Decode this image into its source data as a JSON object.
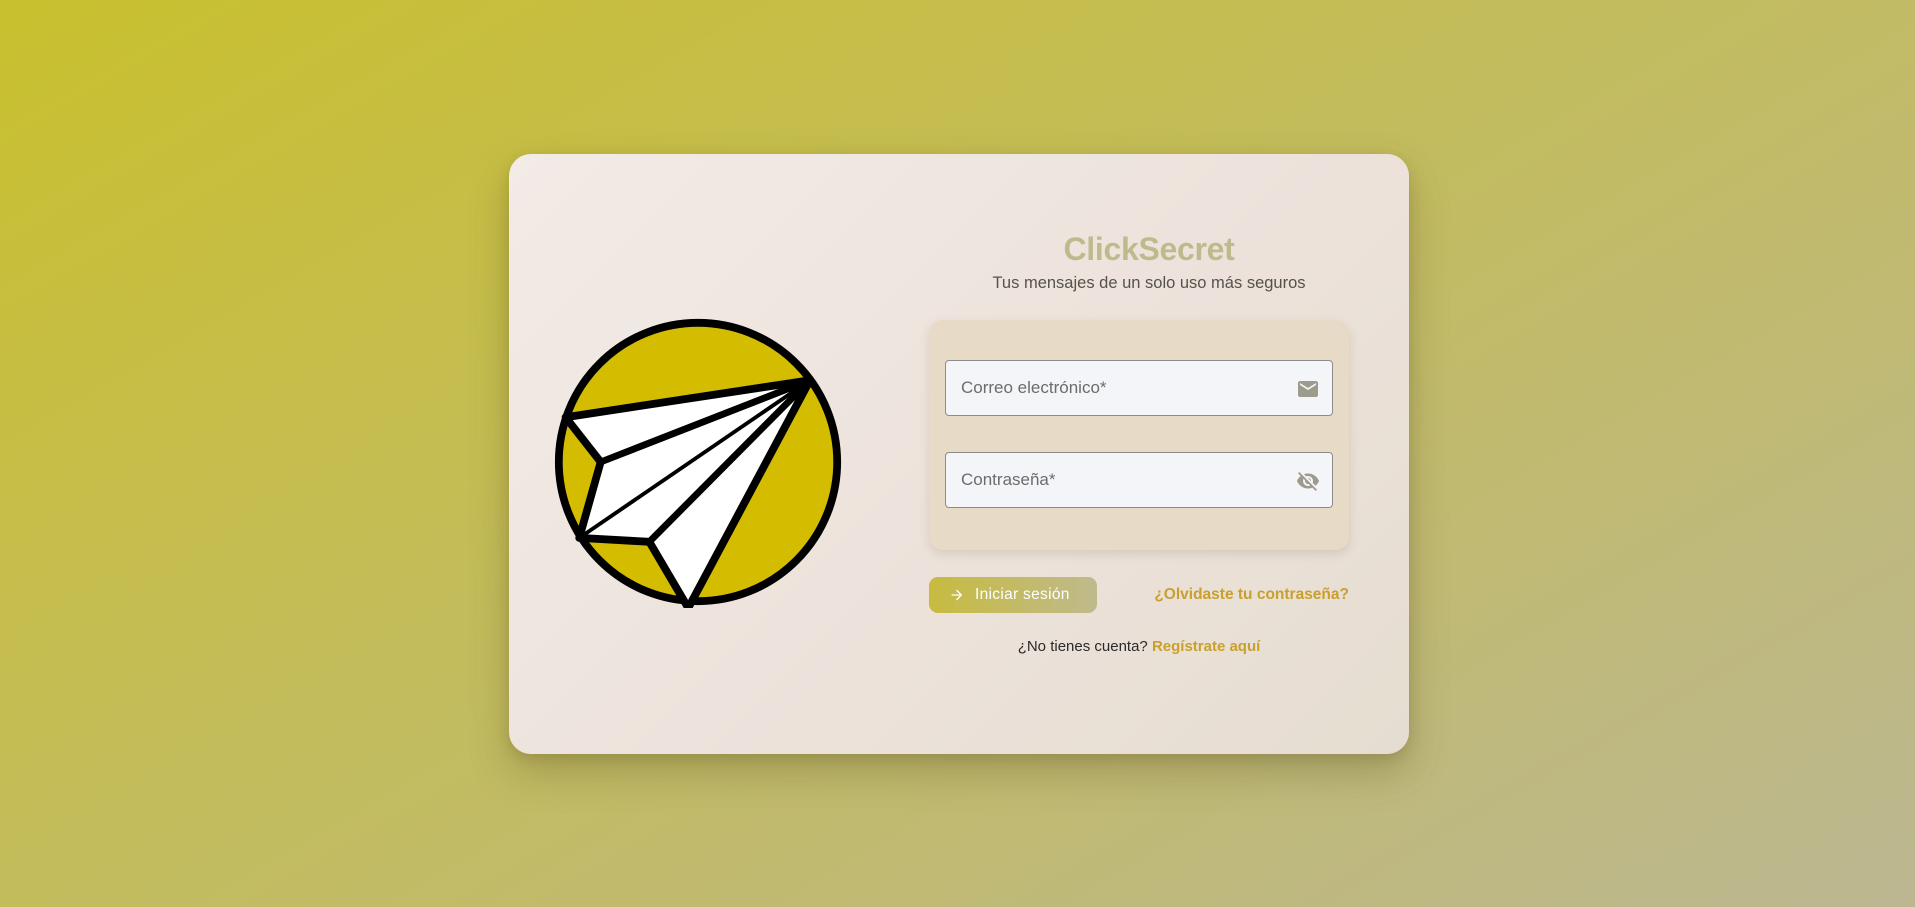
{
  "brand": {
    "title": "ClickSecret",
    "subtitle": "Tus mensajes de un solo uso más seguros",
    "logo_icon": "paper-plane-logo-icon"
  },
  "form": {
    "email": {
      "placeholder": "Correo electrónico*",
      "value": "",
      "icon": "mail-icon"
    },
    "password": {
      "placeholder": "Contraseña*",
      "value": "",
      "icon": "eye-off-icon"
    }
  },
  "actions": {
    "login_label": "Iniciar sesión",
    "login_icon": "arrow-right-icon",
    "forgot_label": "¿Olvidaste tu contraseña?"
  },
  "register": {
    "prompt": "¿No tienes cuenta?",
    "link_label": "Regístrate aquí"
  },
  "colors": {
    "accent": "#c9a02c",
    "brand_title": "#bfba8c",
    "logo_yellow": "#d4bd00"
  }
}
